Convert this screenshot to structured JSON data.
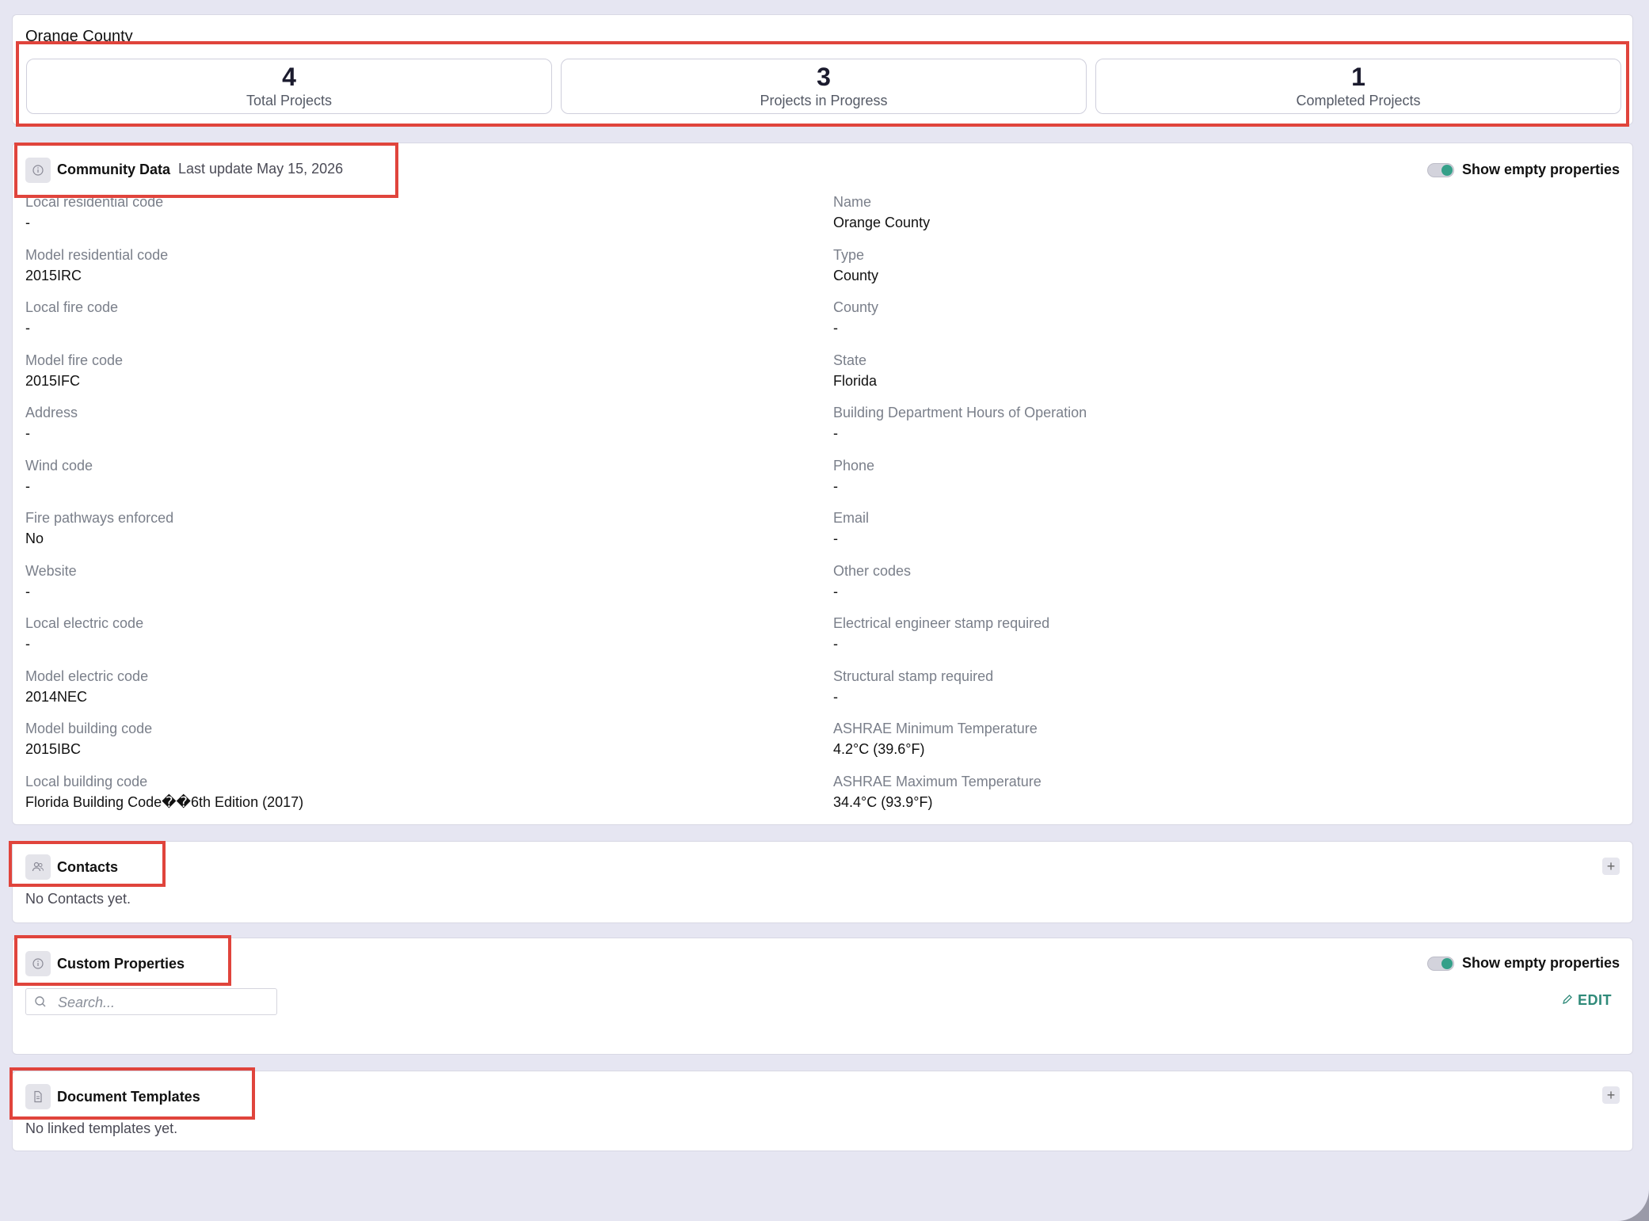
{
  "summary": {
    "title": "Orange County",
    "stats": [
      {
        "value": "4",
        "label": "Total Projects"
      },
      {
        "value": "3",
        "label": "Projects in Progress"
      },
      {
        "value": "1",
        "label": "Completed Projects"
      }
    ]
  },
  "community": {
    "title": "Community Data",
    "last_update": "Last update May 15, 2026",
    "toggle_label": "Show empty properties",
    "left": [
      {
        "label": "Local residential code",
        "value": "-"
      },
      {
        "label": "Model residential code",
        "value": "2015IRC"
      },
      {
        "label": "Local fire code",
        "value": "-"
      },
      {
        "label": "Model fire code",
        "value": "2015IFC"
      },
      {
        "label": "Address",
        "value": "-"
      },
      {
        "label": "Wind code",
        "value": "-"
      },
      {
        "label": "Fire pathways enforced",
        "value": "No"
      },
      {
        "label": "Website",
        "value": "-"
      },
      {
        "label": "Local electric code",
        "value": "-"
      },
      {
        "label": "Model electric code",
        "value": "2014NEC"
      },
      {
        "label": "Model building code",
        "value": "2015IBC"
      },
      {
        "label": "Local building code",
        "value": "Florida Building Code��6th Edition (2017)"
      }
    ],
    "right": [
      {
        "label": "Name",
        "value": "Orange County"
      },
      {
        "label": "Type",
        "value": "County"
      },
      {
        "label": "County",
        "value": "-"
      },
      {
        "label": "State",
        "value": "Florida"
      },
      {
        "label": "Building Department Hours of Operation",
        "value": "-"
      },
      {
        "label": "Phone",
        "value": "-"
      },
      {
        "label": "Email",
        "value": "-"
      },
      {
        "label": "Other codes",
        "value": "-"
      },
      {
        "label": "Electrical engineer stamp required",
        "value": "-"
      },
      {
        "label": "Structural stamp required",
        "value": "-"
      },
      {
        "label": "ASHRAE Minimum Temperature",
        "value": "4.2°C (39.6°F)"
      },
      {
        "label": "ASHRAE Maximum Temperature",
        "value": "34.4°C (93.9°F)"
      }
    ]
  },
  "contacts": {
    "title": "Contacts",
    "empty_text": "No Contacts yet.",
    "add_label": "+"
  },
  "custom_properties": {
    "title": "Custom Properties",
    "toggle_label": "Show empty properties",
    "search_placeholder": "Search...",
    "edit_label": "EDIT"
  },
  "document_templates": {
    "title": "Document Templates",
    "empty_text": "No linked templates yet.",
    "add_label": "+"
  },
  "colors": {
    "accent": "#35a089",
    "highlight": "#e0443c",
    "background": "#e6e6f2"
  },
  "icons": {
    "community": "info-circle-icon",
    "contacts": "users-icon",
    "custom_properties": "info-circle-icon",
    "document_templates": "document-icon",
    "search": "search-icon",
    "edit": "pencil-icon"
  }
}
